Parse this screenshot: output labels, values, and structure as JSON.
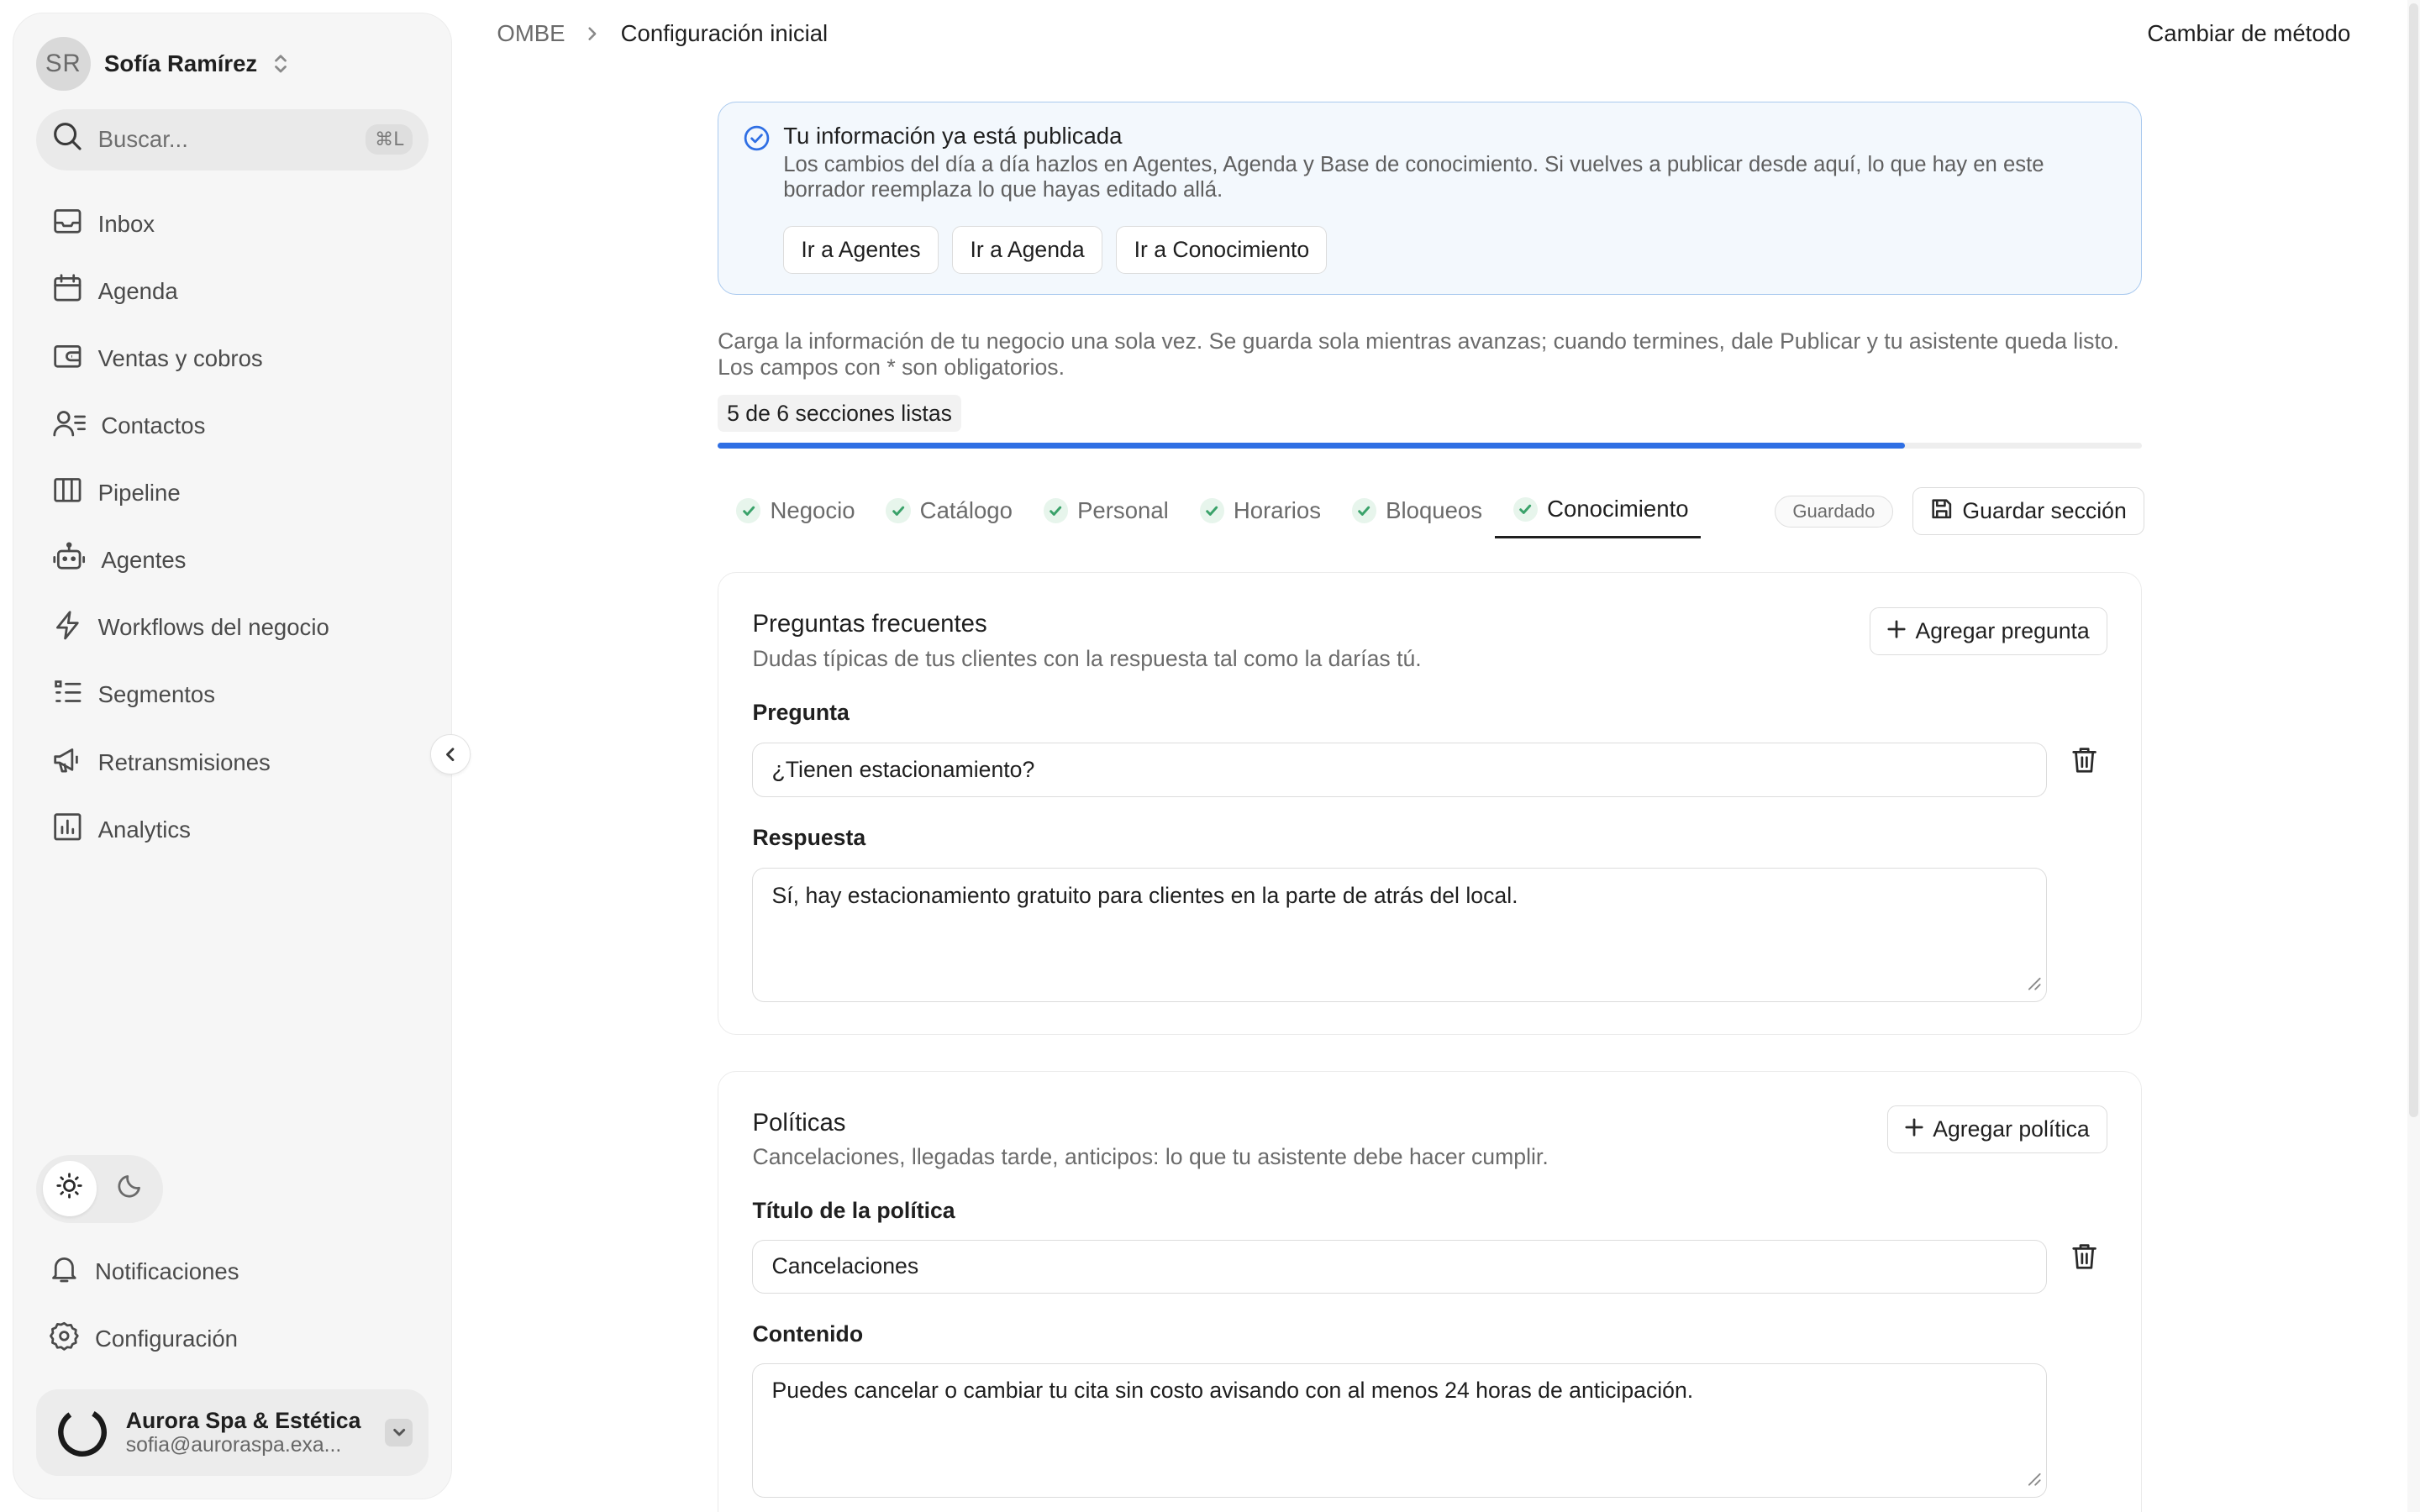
{
  "user": {
    "initials": "SR",
    "name": "Sofía Ramírez"
  },
  "search": {
    "placeholder": "Buscar...",
    "shortcut": "⌘L"
  },
  "sidebar": {
    "items": [
      {
        "label": "Inbox",
        "icon": "inbox-icon"
      },
      {
        "label": "Agenda",
        "icon": "calendar-icon"
      },
      {
        "label": "Ventas y cobros",
        "icon": "wallet-icon"
      },
      {
        "label": "Contactos",
        "icon": "contacts-icon"
      },
      {
        "label": "Pipeline",
        "icon": "columns-icon"
      },
      {
        "label": "Agentes",
        "icon": "bot-icon"
      },
      {
        "label": "Workflows del negocio",
        "icon": "lightning-icon"
      },
      {
        "label": "Segmentos",
        "icon": "list-icon"
      },
      {
        "label": "Retransmisiones",
        "icon": "megaphone-icon"
      },
      {
        "label": "Analytics",
        "icon": "chart-icon"
      }
    ],
    "bottom_items": [
      {
        "label": "Notificaciones",
        "icon": "bell-icon"
      },
      {
        "label": "Configuración",
        "icon": "gear-icon"
      }
    ]
  },
  "org": {
    "name": "Aurora Spa & Estética",
    "email": "sofia@auroraspa.exa..."
  },
  "breadcrumb": {
    "root": "OMBE",
    "current": "Configuración inicial"
  },
  "header": {
    "action": "Cambiar de método"
  },
  "banner": {
    "title": "Tu información ya está publicada",
    "description": "Los cambios del día a día hazlos en Agentes, Agenda y Base de conocimiento. Si vuelves a publicar desde aquí, lo que hay en este borrador reemplaza lo que hayas editado allá.",
    "buttons": [
      "Ir a Agentes",
      "Ir a Agenda",
      "Ir a Conocimiento"
    ]
  },
  "intro": "Carga la información de tu negocio una sola vez. Se guarda sola mientras avanzas; cuando termines, dale Publicar y tu asistente queda listo. Los campos con * son obligatorios.",
  "progress": {
    "label": "5 de 6 secciones listas",
    "completed": 5,
    "total": 6
  },
  "tabs": [
    "Negocio",
    "Catálogo",
    "Personal",
    "Horarios",
    "Bloqueos",
    "Conocimiento"
  ],
  "active_tab": "Conocimiento",
  "status_badge": "Guardado",
  "save_section_label": "Guardar sección",
  "faq": {
    "title": "Preguntas frecuentes",
    "subtitle": "Dudas típicas de tus clientes con la respuesta tal como la darías tú.",
    "add_label": "Agregar pregunta",
    "question_label": "Pregunta",
    "question_value": "¿Tienen estacionamiento?",
    "answer_label": "Respuesta",
    "answer_value": "Sí, hay estacionamiento gratuito para clientes en la parte de atrás del local."
  },
  "policies": {
    "title": "Políticas",
    "subtitle": "Cancelaciones, llegadas tarde, anticipos: lo que tu asistente debe hacer cumplir.",
    "add_label": "Agregar política",
    "title_label": "Título de la política",
    "title_value": "Cancelaciones",
    "content_label": "Contenido",
    "content_value": "Puedes cancelar o cambiar tu cita sin costo avisando con al menos 24 horas de anticipación."
  },
  "colors": {
    "accent": "#2f6fe4",
    "check": "#3aa26a",
    "banner_border": "#a9c9ee"
  }
}
